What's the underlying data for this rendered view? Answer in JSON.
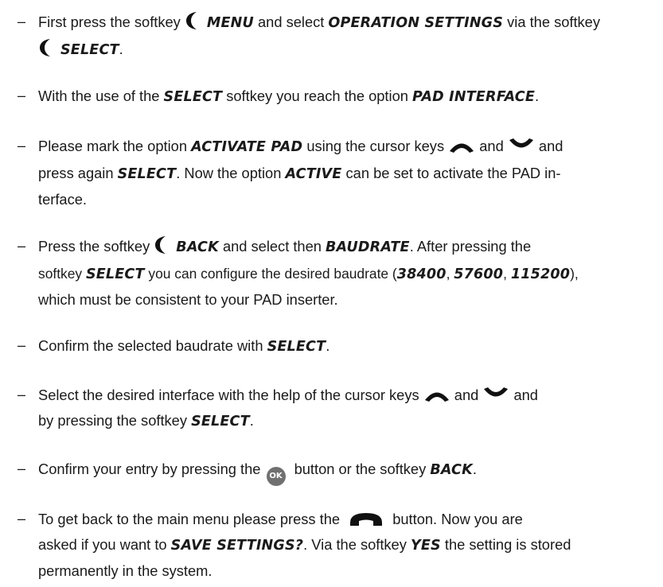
{
  "bullet": "–",
  "icons": {
    "softkey_left": "crescent-softkey-icon",
    "cursor_up": "cursor-up-icon",
    "cursor_down": "cursor-down-icon",
    "ok_button": "ok-button-icon",
    "hangup_button": "hangup-phone-icon"
  },
  "colors": {
    "text": "#1a1a1a",
    "ok_button": "#707070",
    "hangup_button": "#111111"
  },
  "steps": [
    {
      "t1": "First press the softkey ",
      "k1": "MENU",
      "t2": " and select ",
      "k2": "OPERATION SETTINGS",
      "t3": " via the softkey",
      "k3": "SELECT",
      "t4": "."
    },
    {
      "t1": "With the use of the ",
      "k1": "SELECT",
      "t2": " softkey you reach the option ",
      "k2": "PAD INTERFACE",
      "t3": "."
    },
    {
      "t1": "Please mark the option ",
      "k1": "ACTIVATE PAD",
      "t2": " using the cursor keys ",
      "t3": " and ",
      "t4": " and",
      "t5": "press again ",
      "k2": "SELECT",
      "t6": ". Now the option ",
      "k3": "ACTIVE",
      "t7": " can be set to activate the PAD in-",
      "t8": "terface."
    },
    {
      "t1": "Press the softkey ",
      "k1": "BACK",
      "t2": " and select then ",
      "k2": "BAUDRATE",
      "t3": ". After pressing the",
      "t4": "softkey ",
      "k3": "SELECT",
      "t5": " you can configure the desired baudrate (",
      "k4": "38400",
      "t6": ", ",
      "k5": "57600",
      "t7": ", ",
      "k6": "115200",
      "t8": "),",
      "t9": "which must be consistent to your PAD inserter."
    },
    {
      "t1": "Confirm the selected baudrate with ",
      "k1": "SELECT",
      "t2": "."
    },
    {
      "t1": "Select the desired interface with the help of the cursor keys ",
      "t2": " and ",
      "t3": " and",
      "t4": "by pressing the softkey ",
      "k1": "SELECT",
      "t5": "."
    },
    {
      "t1": "Confirm your entry by pressing the ",
      "ok": "OK",
      "t2": " button or the softkey ",
      "k1": "BACK",
      "t3": "."
    },
    {
      "t1": "To get back to the main menu please press the ",
      "t2": " button. Now you are",
      "t3": "asked if you want to ",
      "k1": "SAVE SETTINGS?",
      "t4": ". Via the softkey ",
      "k2": "YES",
      "t5": " the setting is stored",
      "t6": "permanently in the system."
    }
  ]
}
